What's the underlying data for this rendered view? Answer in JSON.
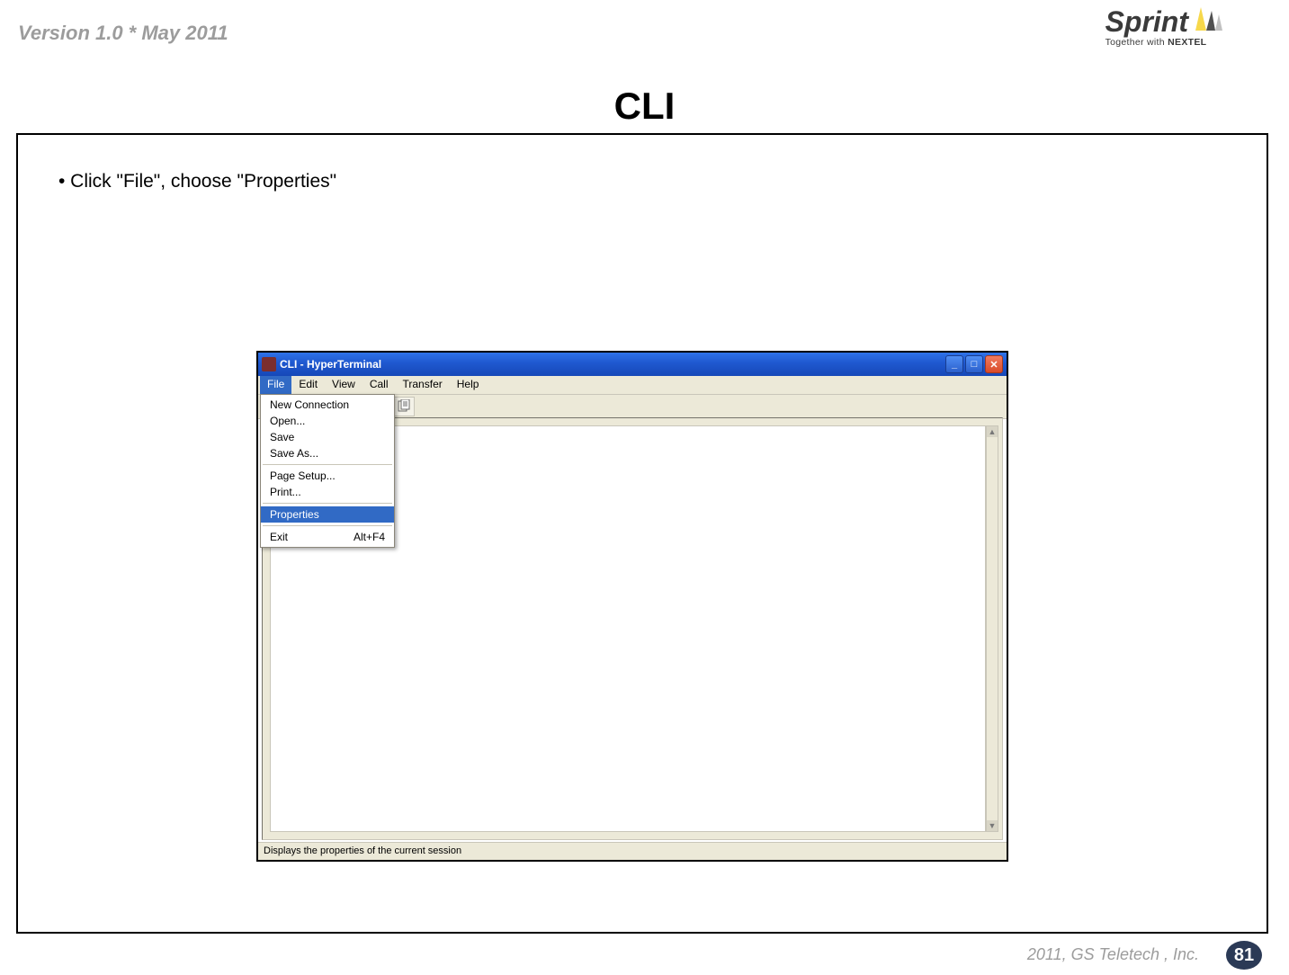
{
  "header": {
    "version_text": "Version 1.0 * May 2011",
    "logo_brand": "Sprint",
    "logo_tagline_prefix": "Together with ",
    "logo_tagline_bold": "NEXTEL"
  },
  "slide": {
    "title": "CLI",
    "bullet": "• Click \"File\", choose \"Properties\""
  },
  "window": {
    "title": "CLI - HyperTerminal",
    "menubar": [
      "File",
      "Edit",
      "View",
      "Call",
      "Transfer",
      "Help"
    ],
    "active_menu_index": 0,
    "file_menu": {
      "items": [
        {
          "label": "New Connection",
          "type": "item"
        },
        {
          "label": "Open...",
          "type": "item"
        },
        {
          "label": "Save",
          "type": "item"
        },
        {
          "label": "Save As...",
          "type": "item"
        },
        {
          "type": "sep"
        },
        {
          "label": "Page Setup...",
          "type": "item"
        },
        {
          "label": "Print...",
          "type": "item"
        },
        {
          "type": "sep"
        },
        {
          "label": "Properties",
          "type": "item",
          "selected": true
        },
        {
          "type": "sep"
        },
        {
          "label": "Exit",
          "shortcut": "Alt+F4",
          "type": "item"
        }
      ]
    },
    "statusbar_text": "Displays the properties of the current session"
  },
  "footer": {
    "copyright": "2011, GS Teletech , Inc.",
    "page_number": "81"
  }
}
